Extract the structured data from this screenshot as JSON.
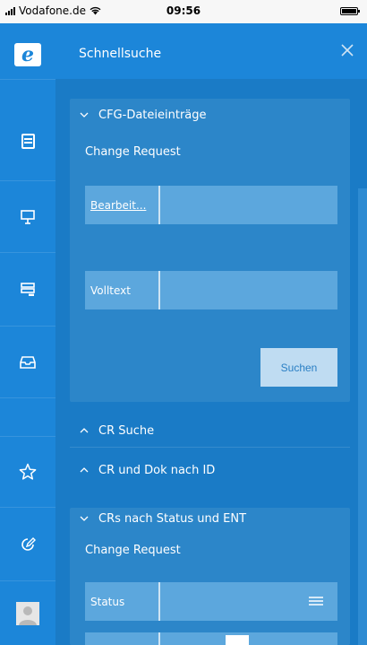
{
  "status_bar": {
    "carrier": "Vodafone.de",
    "time": "09:56"
  },
  "header": {
    "title": "Schnellsuche"
  },
  "sidebar": {
    "icons": [
      "logo-e-icon",
      "catalog-icon",
      "presentation-icon",
      "server-icon",
      "inbox-icon",
      "star-icon",
      "edit-icon",
      "user-icon"
    ]
  },
  "sections": {
    "cfg": {
      "title": "CFG-Dateieinträge",
      "label": "Change Request",
      "fields": [
        {
          "label": "Bearbeit...",
          "value": ""
        },
        {
          "label": "Volltext",
          "value": ""
        }
      ],
      "button": "Suchen"
    },
    "cr_suche": {
      "title": "CR Suche"
    },
    "cr_dok": {
      "title": "CR und Dok nach ID"
    },
    "status_ent": {
      "title": "CRs nach Status und ENT",
      "label": "Change Request",
      "fields": [
        {
          "label": "Status",
          "value": ""
        }
      ]
    }
  },
  "colors": {
    "sidebar": "#1c86d9",
    "panel": "#1a7bc6",
    "card": "#2c86c9",
    "field": "#5ca7dd",
    "button": "#bfdcf2"
  }
}
